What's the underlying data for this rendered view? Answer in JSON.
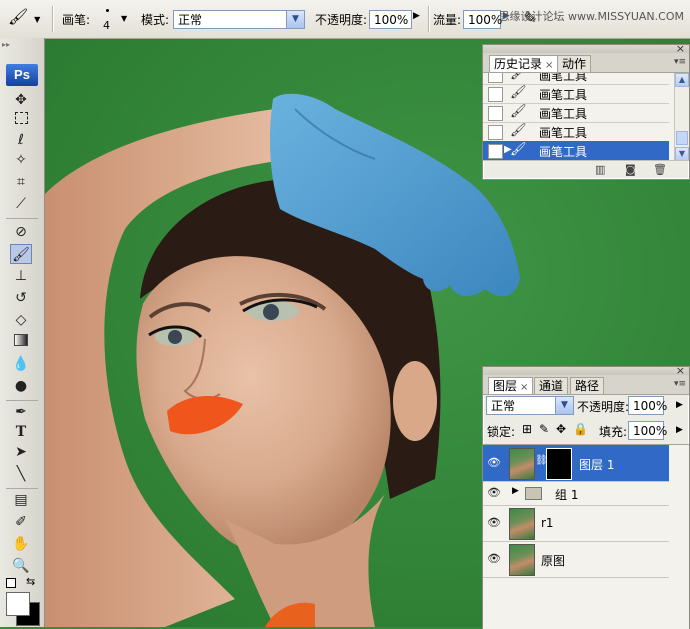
{
  "options_bar": {
    "brush_label": "画笔:",
    "brush_size": "4",
    "mode_label": "模式:",
    "mode_value": "正常",
    "opacity_label": "不透明度:",
    "opacity_value": "100%",
    "flow_label": "流量:",
    "flow_value": "100%",
    "watermark": "思缘设计论坛 www.MISSYUAN.COM"
  },
  "toolbox": {
    "logo": "Ps",
    "tools": [
      "move-tool",
      "marquee-tool",
      "lasso-tool",
      "magic-wand-tool",
      "crop-tool",
      "slice-tool",
      "healing-brush-tool",
      "brush-tool",
      "clone-stamp-tool",
      "history-brush-tool",
      "eraser-tool",
      "gradient-tool",
      "blur-tool",
      "dodge-tool",
      "pen-tool",
      "type-tool",
      "path-selection-tool",
      "line-tool",
      "notes-tool",
      "eyedropper-tool",
      "hand-tool",
      "zoom-tool"
    ],
    "active_tool": "brush-tool",
    "foreground_color": "#ffffff",
    "background_color": "#000000"
  },
  "history_panel": {
    "tabs": [
      {
        "label": "历史记录",
        "active": true
      },
      {
        "label": "动作",
        "active": false
      }
    ],
    "items": [
      {
        "label": "画笔工具",
        "selected": false
      },
      {
        "label": "画笔工具",
        "selected": false
      },
      {
        "label": "画笔工具",
        "selected": false
      },
      {
        "label": "画笔工具",
        "selected": false
      },
      {
        "label": "画笔工具",
        "selected": true
      }
    ]
  },
  "layers_panel": {
    "tabs": [
      {
        "label": "图层",
        "active": true
      },
      {
        "label": "通道",
        "active": false
      },
      {
        "label": "路径",
        "active": false
      }
    ],
    "blend_mode": "正常",
    "opacity_label": "不透明度:",
    "opacity_value": "100%",
    "lock_label": "锁定:",
    "fill_label": "填充:",
    "fill_value": "100%",
    "layers": [
      {
        "name": "图层 1",
        "selected": true,
        "has_mask": true
      },
      {
        "name": "组 1",
        "selected": false,
        "group": true
      },
      {
        "name": "r1",
        "selected": false
      },
      {
        "name": "原图",
        "selected": false
      }
    ]
  },
  "colors": {
    "canvas_bg": "#2f8035",
    "selection": "#3169c6",
    "glove": "#4f9bd0",
    "lips": "#f0561c"
  }
}
